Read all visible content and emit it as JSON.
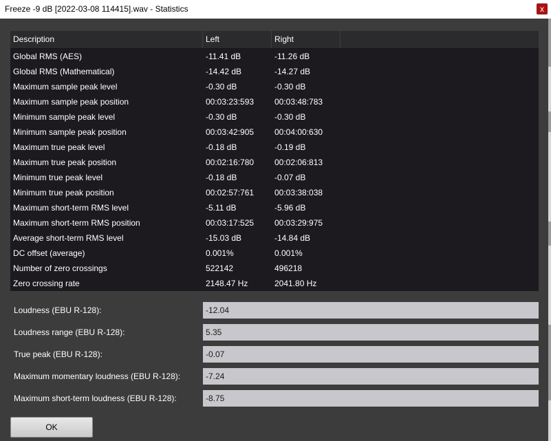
{
  "window": {
    "title": "Freeze -9 dB [2022-03-08 114415].wav - Statistics",
    "close_glyph": "x"
  },
  "table": {
    "headers": {
      "description": "Description",
      "left": "Left",
      "right": "Right"
    },
    "rows": [
      {
        "description": "Global RMS (AES)",
        "left": "-11.41 dB",
        "right": "-11.26 dB"
      },
      {
        "description": "Global RMS (Mathematical)",
        "left": "-14.42 dB",
        "right": "-14.27 dB"
      },
      {
        "description": "Maximum sample peak level",
        "left": "-0.30 dB",
        "right": "-0.30 dB"
      },
      {
        "description": "Maximum sample peak position",
        "left": "00:03:23:593",
        "right": "00:03:48:783"
      },
      {
        "description": "Minimum sample peak level",
        "left": "-0.30 dB",
        "right": "-0.30 dB"
      },
      {
        "description": "Minimum sample peak position",
        "left": "00:03:42:905",
        "right": "00:04:00:630"
      },
      {
        "description": "Maximum true peak level",
        "left": "-0.18 dB",
        "right": "-0.19 dB"
      },
      {
        "description": "Maximum true peak position",
        "left": "00:02:16:780",
        "right": "00:02:06:813"
      },
      {
        "description": "Minimum true peak level",
        "left": "-0.18 dB",
        "right": "-0.07 dB"
      },
      {
        "description": "Minimum true peak position",
        "left": "00:02:57:761",
        "right": "00:03:38:038"
      },
      {
        "description": "Maximum short-term RMS level",
        "left": "-5.11 dB",
        "right": "-5.96 dB"
      },
      {
        "description": "Maximum short-term RMS position",
        "left": "00:03:17:525",
        "right": "00:03:29:975"
      },
      {
        "description": "Average short-term RMS level",
        "left": "-15.03 dB",
        "right": "-14.84 dB"
      },
      {
        "description": "DC offset (average)",
        "left": "0.001%",
        "right": "0.001%"
      },
      {
        "description": "Number of zero crossings",
        "left": "522142",
        "right": "496218"
      },
      {
        "description": "Zero crossing rate",
        "left": "2148.47 Hz",
        "right": "2041.80 Hz"
      }
    ]
  },
  "loudness": [
    {
      "label": "Loudness (EBU R-128):",
      "value": "-12.04"
    },
    {
      "label": "Loudness range (EBU R-128):",
      "value": "5.35"
    },
    {
      "label": "True peak (EBU R-128):",
      "value": "-0.07"
    },
    {
      "label": "Maximum momentary loudness (EBU R-128):",
      "value": "-7.24"
    },
    {
      "label": "Maximum short-term loudness (EBU R-128):",
      "value": "-8.75"
    }
  ],
  "buttons": {
    "ok": "OK"
  }
}
